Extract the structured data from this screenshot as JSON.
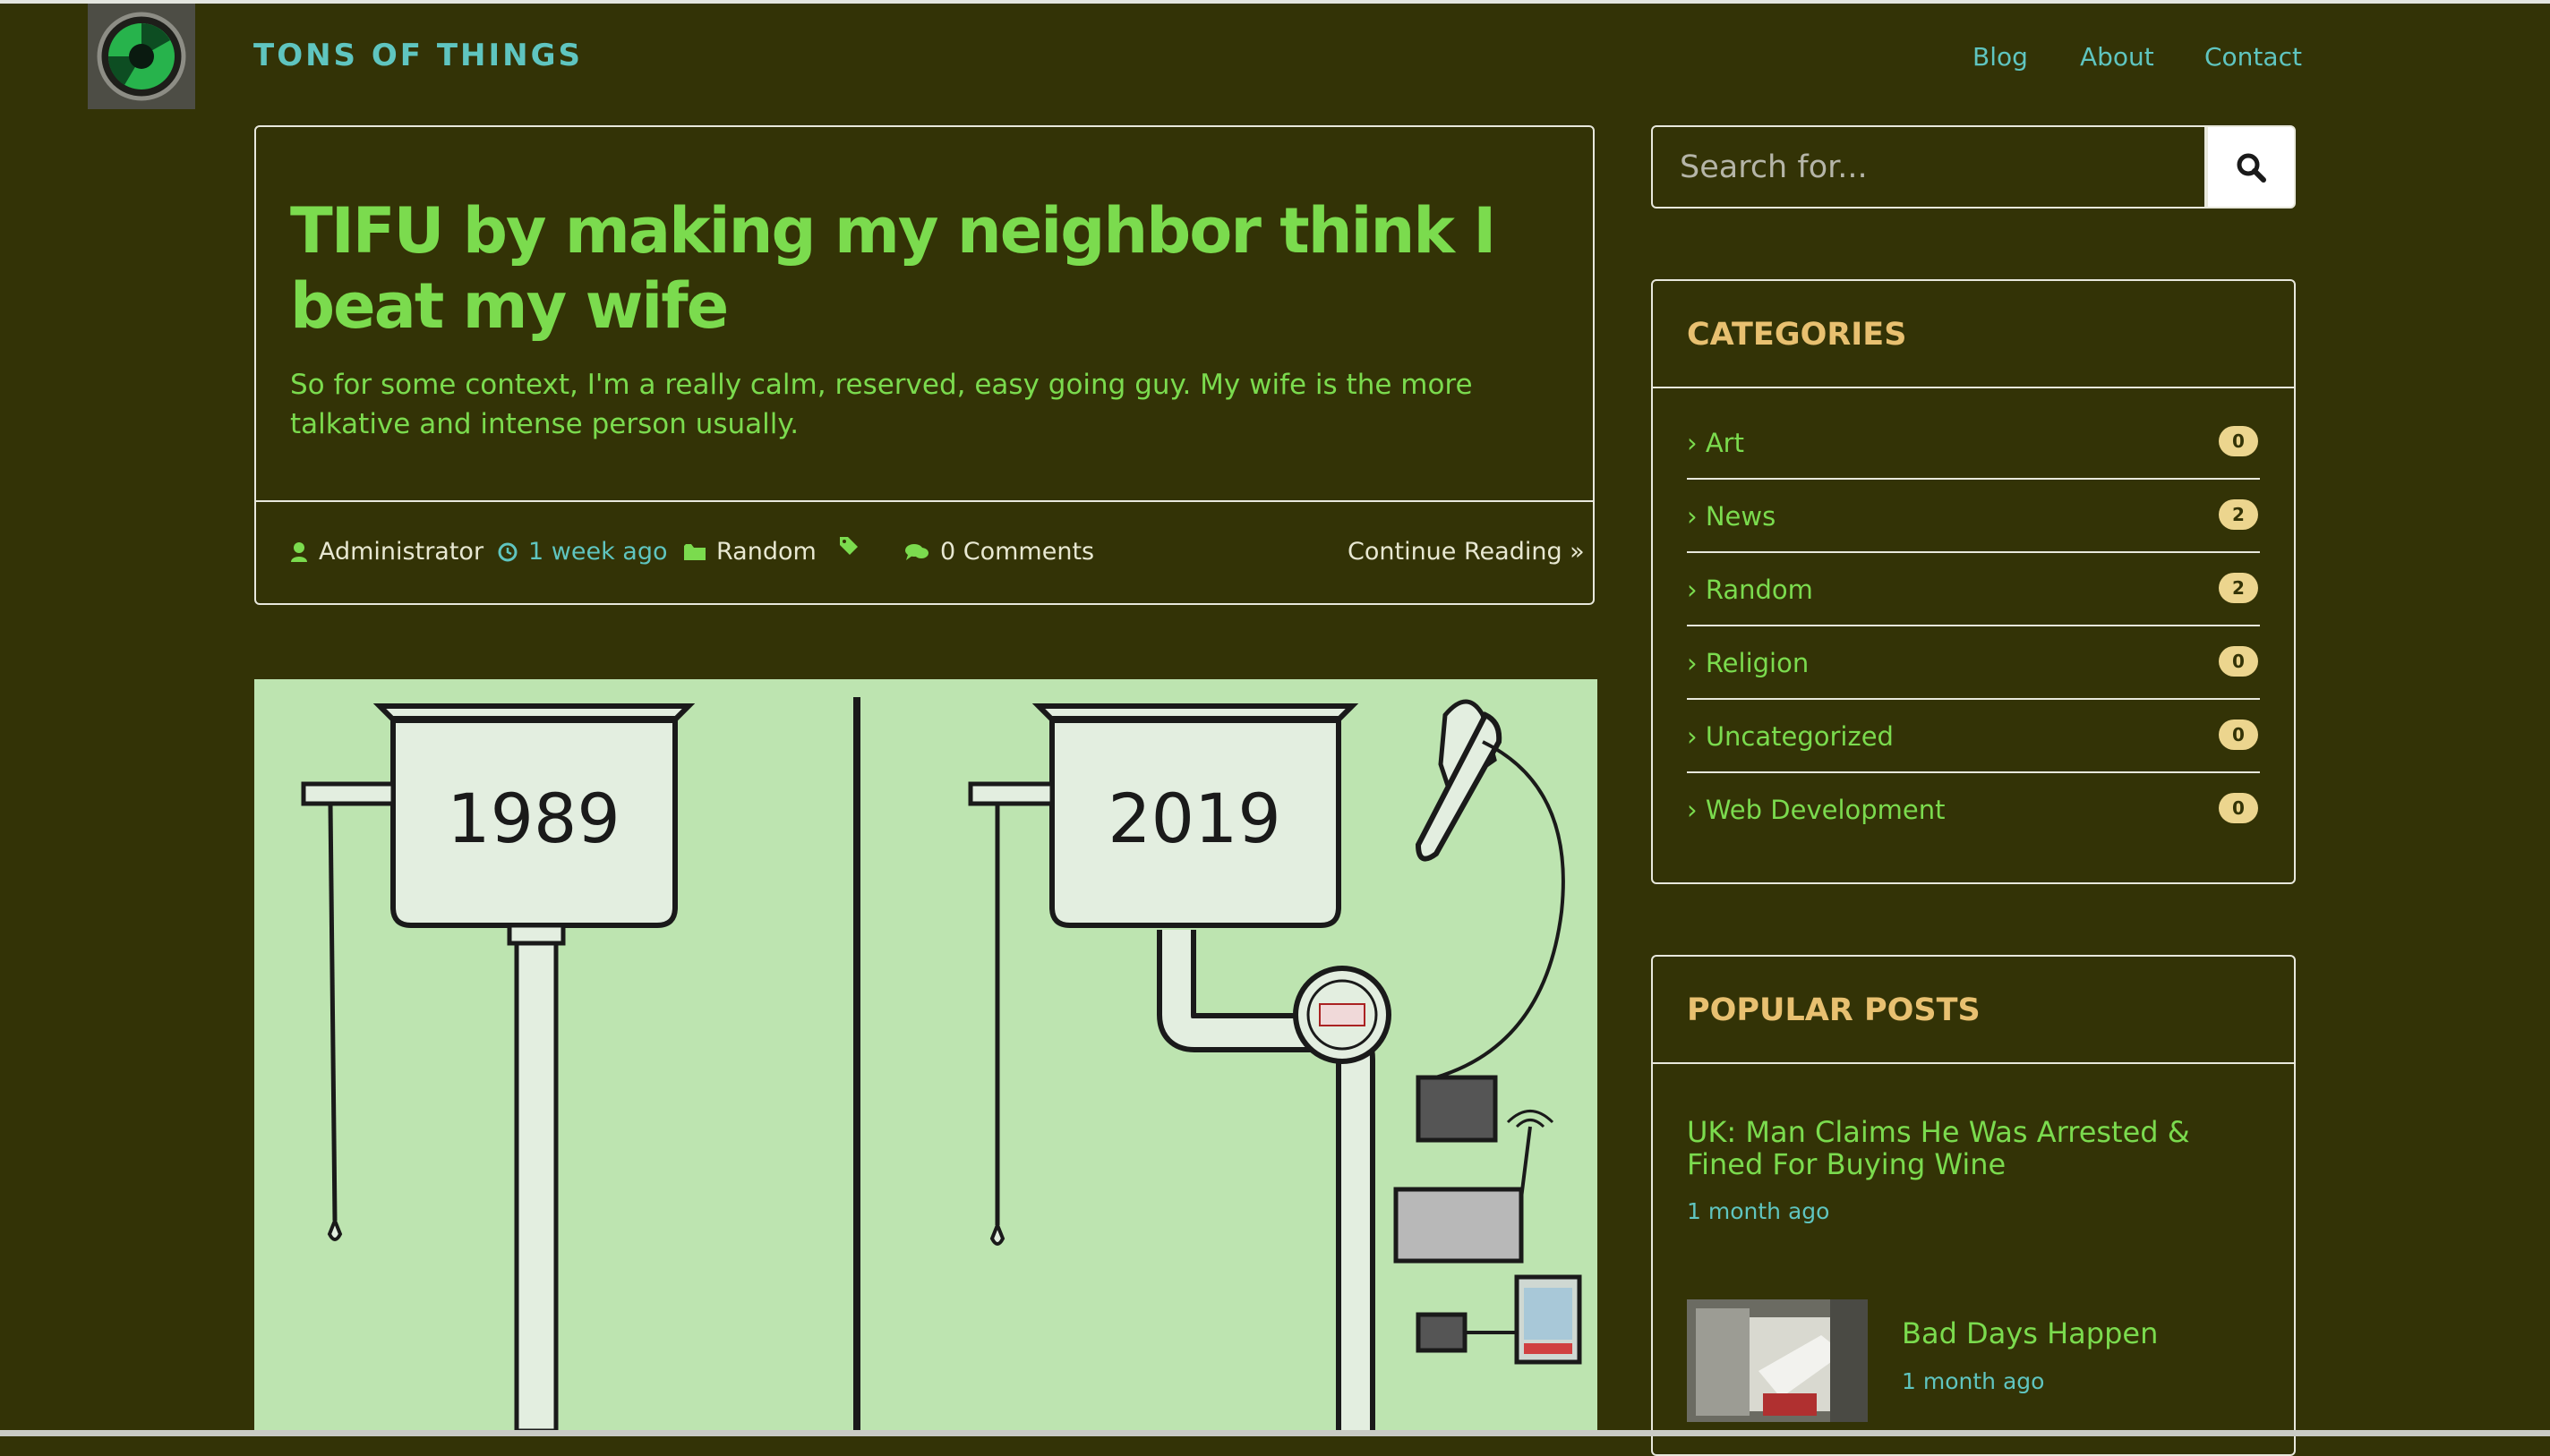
{
  "site": {
    "brand": "TONS OF THINGS",
    "nav": [
      "Blog",
      "About",
      "Contact"
    ]
  },
  "post": {
    "title": "TIFU by making my neighbor think I beat my wife",
    "excerpt": "So for some context, I'm a really calm, reserved, easy going guy. My wife is the more talkative and intense person usually.",
    "author": "Administrator",
    "time": "1 week ago",
    "category": "Random",
    "comments": "0 Comments",
    "continue_label": "Continue Reading »",
    "image": {
      "left_label": "1989",
      "right_label": "2019"
    }
  },
  "search": {
    "placeholder": "Search for..."
  },
  "categories": {
    "title": "CATEGORIES",
    "items": [
      {
        "label": "Art",
        "count": "0"
      },
      {
        "label": "News",
        "count": "2"
      },
      {
        "label": "Random",
        "count": "2"
      },
      {
        "label": "Religion",
        "count": "0"
      },
      {
        "label": "Uncategorized",
        "count": "0"
      },
      {
        "label": "Web Development",
        "count": "0"
      }
    ]
  },
  "popular": {
    "title": "POPULAR POSTS",
    "posts": [
      {
        "title": "UK: Man Claims He Was Arrested & Fined For Buying Wine",
        "time": "1 month ago"
      },
      {
        "title": "Bad Days Happen",
        "time": "1 month ago"
      }
    ]
  },
  "colors": {
    "background": "#333306",
    "headline_green": "#7bdb4e",
    "link_teal": "#5fc5c0",
    "widget_title": "#e8c070",
    "badge": "#ecd58e",
    "image_background": "#bde4b0"
  }
}
